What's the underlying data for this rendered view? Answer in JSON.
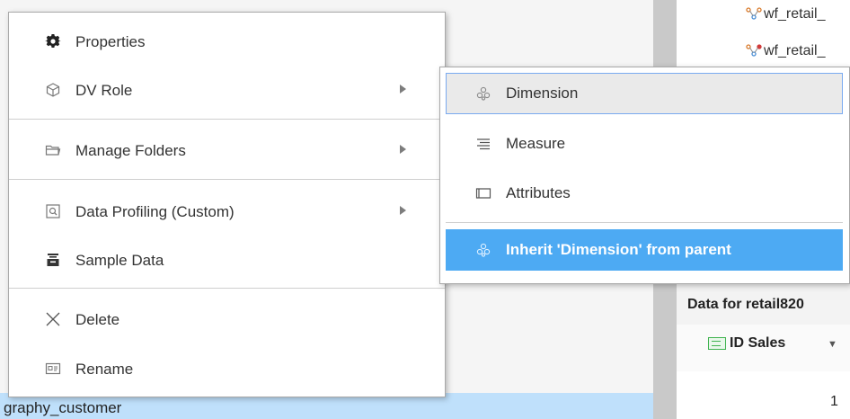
{
  "background": {
    "selected_row_text": "graphy_customer",
    "workflow_items": [
      "wf_retail_",
      "wf_retail_"
    ],
    "data_panel_title": "Data for retail820",
    "column_header": "ID Sales",
    "first_cell_value": "1"
  },
  "context_menu": {
    "items": [
      {
        "label": "Properties",
        "icon": "gear-icon"
      },
      {
        "label": "DV Role",
        "icon": "cube-icon",
        "has_submenu": true
      },
      {
        "label": "Manage Folders",
        "icon": "folder-icon",
        "has_submenu": true
      },
      {
        "label": "Data Profiling (Custom)",
        "icon": "profiling-icon",
        "has_submenu": true
      },
      {
        "label": "Sample Data",
        "icon": "sample-data-icon"
      },
      {
        "label": "Delete",
        "icon": "close-icon"
      },
      {
        "label": "Rename",
        "icon": "rename-icon"
      }
    ]
  },
  "submenu": {
    "items": [
      {
        "label": "Dimension",
        "icon": "dimension-icon",
        "state": "hover"
      },
      {
        "label": "Measure",
        "icon": "measure-icon"
      },
      {
        "label": "Attributes",
        "icon": "attributes-icon"
      },
      {
        "label": "Inherit 'Dimension' from parent",
        "icon": "dimension-icon",
        "state": "selected"
      }
    ]
  },
  "colors": {
    "selected_accent": "#4daaf3",
    "hover_border": "#7aaaf0",
    "selected_row_bg": "#bfe0fb"
  }
}
